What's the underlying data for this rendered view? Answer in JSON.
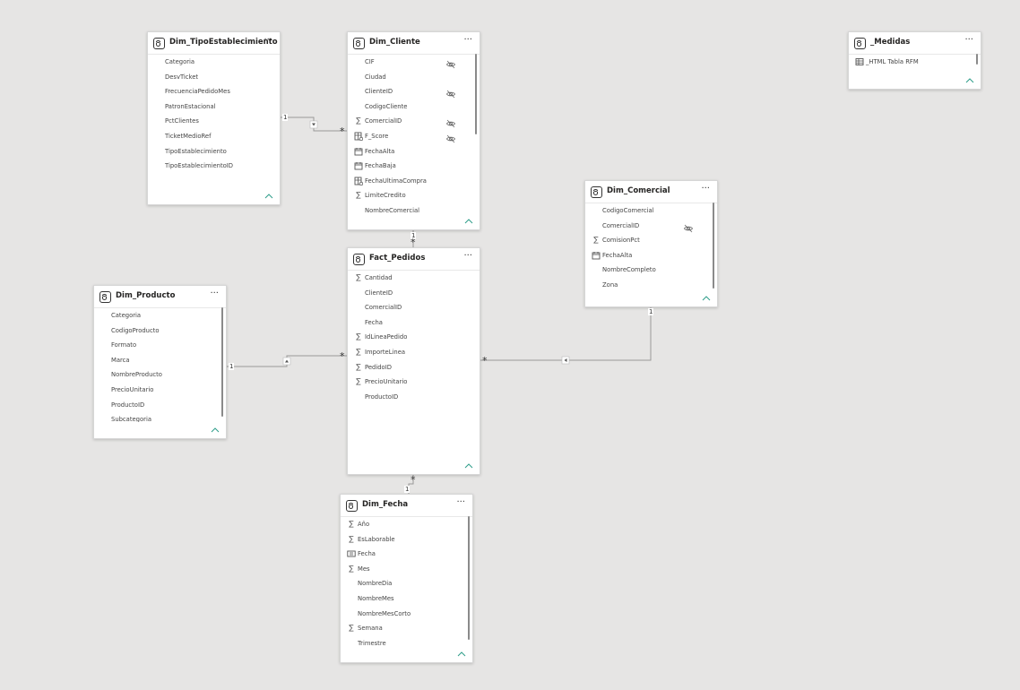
{
  "tables": [
    {
      "id": "dim_tipo",
      "title": "Dim_TipoEstablecimiento",
      "fields": [
        {
          "label": "Categoria",
          "icon": "none",
          "hidden": false
        },
        {
          "label": "DesvTicket",
          "icon": "none",
          "hidden": false
        },
        {
          "label": "FrecuenciaPedidoMes",
          "icon": "none",
          "hidden": false
        },
        {
          "label": "PatronEstacional",
          "icon": "none",
          "hidden": false
        },
        {
          "label": "PctClientes",
          "icon": "none",
          "hidden": false
        },
        {
          "label": "TicketMedioRef",
          "icon": "none",
          "hidden": false
        },
        {
          "label": "TipoEstablecimiento",
          "icon": "none",
          "hidden": false
        },
        {
          "label": "TipoEstablecimientoID",
          "icon": "none",
          "hidden": false
        }
      ]
    },
    {
      "id": "dim_cliente",
      "title": "Dim_Cliente",
      "fields": [
        {
          "label": "CIF",
          "icon": "none",
          "hidden": true
        },
        {
          "label": "Ciudad",
          "icon": "none",
          "hidden": false
        },
        {
          "label": "ClienteID",
          "icon": "none",
          "hidden": true
        },
        {
          "label": "CodigoCliente",
          "icon": "none",
          "hidden": false
        },
        {
          "label": "ComercialID",
          "icon": "sum",
          "hidden": true
        },
        {
          "label": "F_Score",
          "icon": "calc-column",
          "hidden": true
        },
        {
          "label": "FechaAlta",
          "icon": "calendar",
          "hidden": false
        },
        {
          "label": "FechaBaja",
          "icon": "calendar",
          "hidden": false
        },
        {
          "label": "FechaUltimaCompra",
          "icon": "calc-column",
          "hidden": false
        },
        {
          "label": "LimiteCredito",
          "icon": "sum",
          "hidden": false
        },
        {
          "label": "NombreComercial",
          "icon": "none",
          "hidden": false
        }
      ]
    },
    {
      "id": "medidas",
      "title": "_Medidas",
      "fields": [
        {
          "label": "_HTML Tabla RFM",
          "icon": "table",
          "hidden": false
        }
      ]
    },
    {
      "id": "dim_comercial",
      "title": "Dim_Comercial",
      "fields": [
        {
          "label": "CodigoComercial",
          "icon": "none",
          "hidden": false
        },
        {
          "label": "ComercialID",
          "icon": "none",
          "hidden": true
        },
        {
          "label": "ComisionPct",
          "icon": "sum",
          "hidden": false
        },
        {
          "label": "FechaAlta",
          "icon": "calendar",
          "hidden": false
        },
        {
          "label": "NombreCompleto",
          "icon": "none",
          "hidden": false
        },
        {
          "label": "Zona",
          "icon": "none",
          "hidden": false
        }
      ]
    },
    {
      "id": "fact_pedidos",
      "title": "Fact_Pedidos",
      "fields": [
        {
          "label": "Cantidad",
          "icon": "sum",
          "hidden": false
        },
        {
          "label": "ClienteID",
          "icon": "none",
          "hidden": false
        },
        {
          "label": "ComercialID",
          "icon": "none",
          "hidden": false
        },
        {
          "label": "Fecha",
          "icon": "none",
          "hidden": false
        },
        {
          "label": "IdLineaPedido",
          "icon": "sum",
          "hidden": false
        },
        {
          "label": "ImporteLinea",
          "icon": "sum",
          "hidden": false
        },
        {
          "label": "PedidoID",
          "icon": "sum",
          "hidden": false
        },
        {
          "label": "PrecioUnitario",
          "icon": "sum",
          "hidden": false
        },
        {
          "label": "ProductoID",
          "icon": "none",
          "hidden": false
        }
      ]
    },
    {
      "id": "dim_producto",
      "title": "Dim_Producto",
      "fields": [
        {
          "label": "Categoria",
          "icon": "none",
          "hidden": false
        },
        {
          "label": "CodigoProducto",
          "icon": "none",
          "hidden": false
        },
        {
          "label": "Formato",
          "icon": "none",
          "hidden": false
        },
        {
          "label": "Marca",
          "icon": "none",
          "hidden": false
        },
        {
          "label": "NombreProducto",
          "icon": "none",
          "hidden": false
        },
        {
          "label": "PrecioUnitario",
          "icon": "none",
          "hidden": false
        },
        {
          "label": "ProductoID",
          "icon": "none",
          "hidden": false
        },
        {
          "label": "Subcategoria",
          "icon": "none",
          "hidden": false
        }
      ]
    },
    {
      "id": "dim_fecha",
      "title": "Dim_Fecha",
      "fields": [
        {
          "label": "Año",
          "icon": "sum",
          "hidden": false
        },
        {
          "label": "EsLaborable",
          "icon": "sum",
          "hidden": false
        },
        {
          "label": "Fecha",
          "icon": "date-hierarchy",
          "hidden": false
        },
        {
          "label": "Mes",
          "icon": "sum",
          "hidden": false
        },
        {
          "label": "NombreDia",
          "icon": "none",
          "hidden": false
        },
        {
          "label": "NombreMes",
          "icon": "none",
          "hidden": false
        },
        {
          "label": "NombreMesCorto",
          "icon": "none",
          "hidden": false
        },
        {
          "label": "Semana",
          "icon": "sum",
          "hidden": false
        },
        {
          "label": "Trimestre",
          "icon": "none",
          "hidden": false
        }
      ]
    }
  ],
  "relationships": [
    {
      "from": "dim_tipo",
      "to": "dim_cliente",
      "from_card": "1",
      "to_card": "*"
    },
    {
      "from": "dim_cliente",
      "to": "fact_pedidos",
      "from_card": "1",
      "to_card": "*"
    },
    {
      "from": "dim_producto",
      "to": "fact_pedidos",
      "from_card": "1",
      "to_card": "*"
    },
    {
      "from": "dim_comercial",
      "to": "fact_pedidos",
      "from_card": "1",
      "to_card": "*"
    },
    {
      "from": "dim_fecha",
      "to": "fact_pedidos",
      "from_card": "1",
      "to_card": "*"
    }
  ],
  "more_glyph": "···",
  "colors": {
    "canvas": "#e6e5e4",
    "line": "#999999",
    "collapse_chevron": "#2f9e8a"
  }
}
